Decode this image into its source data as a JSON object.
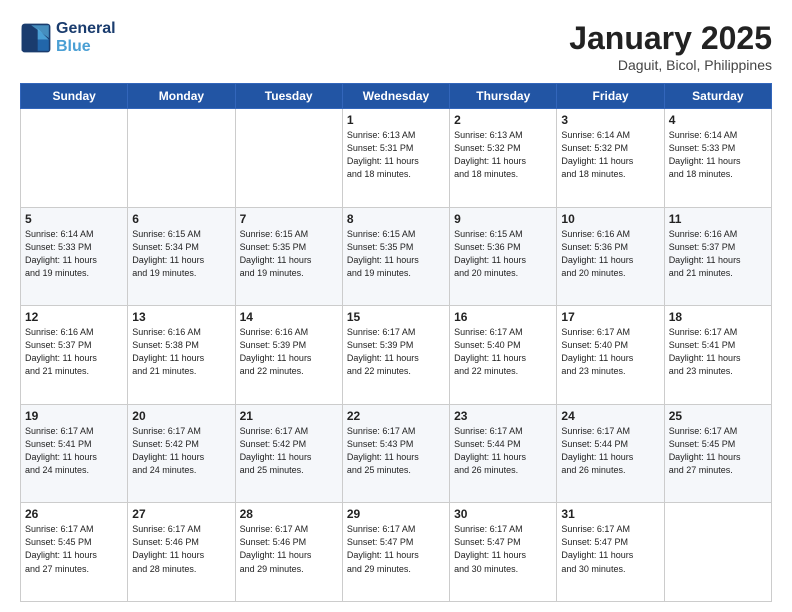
{
  "header": {
    "logo_line1": "General",
    "logo_line2": "Blue",
    "month": "January 2025",
    "location": "Daguit, Bicol, Philippines"
  },
  "weekdays": [
    "Sunday",
    "Monday",
    "Tuesday",
    "Wednesday",
    "Thursday",
    "Friday",
    "Saturday"
  ],
  "weeks": [
    [
      {
        "day": "",
        "info": ""
      },
      {
        "day": "",
        "info": ""
      },
      {
        "day": "",
        "info": ""
      },
      {
        "day": "1",
        "info": "Sunrise: 6:13 AM\nSunset: 5:31 PM\nDaylight: 11 hours\nand 18 minutes."
      },
      {
        "day": "2",
        "info": "Sunrise: 6:13 AM\nSunset: 5:32 PM\nDaylight: 11 hours\nand 18 minutes."
      },
      {
        "day": "3",
        "info": "Sunrise: 6:14 AM\nSunset: 5:32 PM\nDaylight: 11 hours\nand 18 minutes."
      },
      {
        "day": "4",
        "info": "Sunrise: 6:14 AM\nSunset: 5:33 PM\nDaylight: 11 hours\nand 18 minutes."
      }
    ],
    [
      {
        "day": "5",
        "info": "Sunrise: 6:14 AM\nSunset: 5:33 PM\nDaylight: 11 hours\nand 19 minutes."
      },
      {
        "day": "6",
        "info": "Sunrise: 6:15 AM\nSunset: 5:34 PM\nDaylight: 11 hours\nand 19 minutes."
      },
      {
        "day": "7",
        "info": "Sunrise: 6:15 AM\nSunset: 5:35 PM\nDaylight: 11 hours\nand 19 minutes."
      },
      {
        "day": "8",
        "info": "Sunrise: 6:15 AM\nSunset: 5:35 PM\nDaylight: 11 hours\nand 19 minutes."
      },
      {
        "day": "9",
        "info": "Sunrise: 6:15 AM\nSunset: 5:36 PM\nDaylight: 11 hours\nand 20 minutes."
      },
      {
        "day": "10",
        "info": "Sunrise: 6:16 AM\nSunset: 5:36 PM\nDaylight: 11 hours\nand 20 minutes."
      },
      {
        "day": "11",
        "info": "Sunrise: 6:16 AM\nSunset: 5:37 PM\nDaylight: 11 hours\nand 21 minutes."
      }
    ],
    [
      {
        "day": "12",
        "info": "Sunrise: 6:16 AM\nSunset: 5:37 PM\nDaylight: 11 hours\nand 21 minutes."
      },
      {
        "day": "13",
        "info": "Sunrise: 6:16 AM\nSunset: 5:38 PM\nDaylight: 11 hours\nand 21 minutes."
      },
      {
        "day": "14",
        "info": "Sunrise: 6:16 AM\nSunset: 5:39 PM\nDaylight: 11 hours\nand 22 minutes."
      },
      {
        "day": "15",
        "info": "Sunrise: 6:17 AM\nSunset: 5:39 PM\nDaylight: 11 hours\nand 22 minutes."
      },
      {
        "day": "16",
        "info": "Sunrise: 6:17 AM\nSunset: 5:40 PM\nDaylight: 11 hours\nand 22 minutes."
      },
      {
        "day": "17",
        "info": "Sunrise: 6:17 AM\nSunset: 5:40 PM\nDaylight: 11 hours\nand 23 minutes."
      },
      {
        "day": "18",
        "info": "Sunrise: 6:17 AM\nSunset: 5:41 PM\nDaylight: 11 hours\nand 23 minutes."
      }
    ],
    [
      {
        "day": "19",
        "info": "Sunrise: 6:17 AM\nSunset: 5:41 PM\nDaylight: 11 hours\nand 24 minutes."
      },
      {
        "day": "20",
        "info": "Sunrise: 6:17 AM\nSunset: 5:42 PM\nDaylight: 11 hours\nand 24 minutes."
      },
      {
        "day": "21",
        "info": "Sunrise: 6:17 AM\nSunset: 5:42 PM\nDaylight: 11 hours\nand 25 minutes."
      },
      {
        "day": "22",
        "info": "Sunrise: 6:17 AM\nSunset: 5:43 PM\nDaylight: 11 hours\nand 25 minutes."
      },
      {
        "day": "23",
        "info": "Sunrise: 6:17 AM\nSunset: 5:44 PM\nDaylight: 11 hours\nand 26 minutes."
      },
      {
        "day": "24",
        "info": "Sunrise: 6:17 AM\nSunset: 5:44 PM\nDaylight: 11 hours\nand 26 minutes."
      },
      {
        "day": "25",
        "info": "Sunrise: 6:17 AM\nSunset: 5:45 PM\nDaylight: 11 hours\nand 27 minutes."
      }
    ],
    [
      {
        "day": "26",
        "info": "Sunrise: 6:17 AM\nSunset: 5:45 PM\nDaylight: 11 hours\nand 27 minutes."
      },
      {
        "day": "27",
        "info": "Sunrise: 6:17 AM\nSunset: 5:46 PM\nDaylight: 11 hours\nand 28 minutes."
      },
      {
        "day": "28",
        "info": "Sunrise: 6:17 AM\nSunset: 5:46 PM\nDaylight: 11 hours\nand 29 minutes."
      },
      {
        "day": "29",
        "info": "Sunrise: 6:17 AM\nSunset: 5:47 PM\nDaylight: 11 hours\nand 29 minutes."
      },
      {
        "day": "30",
        "info": "Sunrise: 6:17 AM\nSunset: 5:47 PM\nDaylight: 11 hours\nand 30 minutes."
      },
      {
        "day": "31",
        "info": "Sunrise: 6:17 AM\nSunset: 5:47 PM\nDaylight: 11 hours\nand 30 minutes."
      },
      {
        "day": "",
        "info": ""
      }
    ]
  ]
}
